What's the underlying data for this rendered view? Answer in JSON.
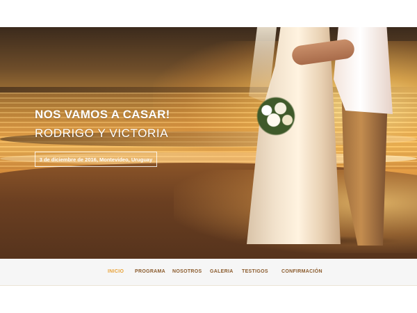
{
  "hero": {
    "title": "NOS VAMOS A CASAR!",
    "subtitle": "RODRIGO Y VICTORIA",
    "date_location": "3 de diciembre de 2016, Montevideo, Uruguay",
    "image_description_icon": "couple-on-beach-photo"
  },
  "nav": {
    "items": [
      {
        "label": "INICIO",
        "active": true
      },
      {
        "label": "PROGRAMA",
        "active": false
      },
      {
        "label": "NOSOTROS",
        "active": false
      },
      {
        "label": "GALERIA",
        "active": false
      },
      {
        "label": "TESTIGOS",
        "active": false
      },
      {
        "label": "CONFIRMACIÓN",
        "active": false
      }
    ]
  },
  "colors": {
    "nav_text": "#8a5a2b",
    "nav_active": "#e8a135",
    "nav_background": "#f6f6f6",
    "hero_text": "#ffffff"
  }
}
